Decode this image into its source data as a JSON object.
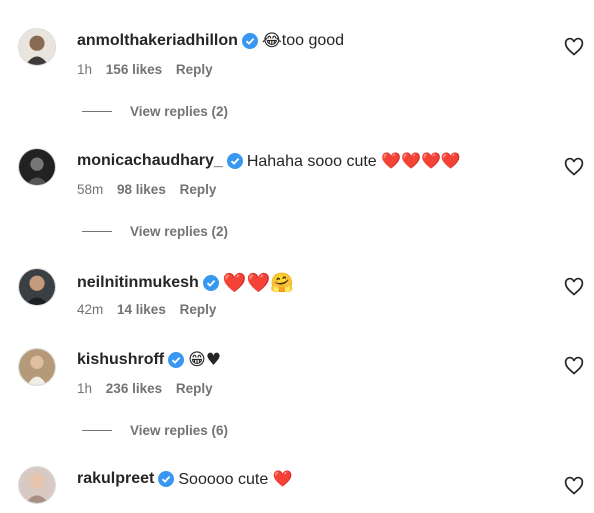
{
  "comments": [
    {
      "username": "anmolthakeriadhillon",
      "verified": true,
      "text": "too good",
      "emoji_before": "😂",
      "time": "1h",
      "likes": "156 likes",
      "reply": "Reply",
      "view_replies": "View replies (2)"
    },
    {
      "username": "monicachaudhary_",
      "verified": true,
      "text": "Hahaha sooo cute ❤️❤️❤️❤️",
      "time": "58m",
      "likes": "98 likes",
      "reply": "Reply",
      "view_replies": "View replies (2)"
    },
    {
      "username": "neilnitinmukesh",
      "verified": true,
      "text": "❤️❤️🤗",
      "time": "42m",
      "likes": "14 likes",
      "reply": "Reply"
    },
    {
      "username": "kishushroff",
      "verified": true,
      "text": "😁♥",
      "time": "1h",
      "likes": "236 likes",
      "reply": "Reply",
      "view_replies": "View replies (6)"
    },
    {
      "username": "rakulpreet",
      "verified": true,
      "text": "Sooooo cute ❤️"
    }
  ],
  "colors": {
    "verified_blue": "#3897f0",
    "heart_red": "#ed1c3d",
    "muted": "#737373"
  },
  "icons": {
    "verified": "verified-badge-icon",
    "like": "heart-outline-icon"
  }
}
